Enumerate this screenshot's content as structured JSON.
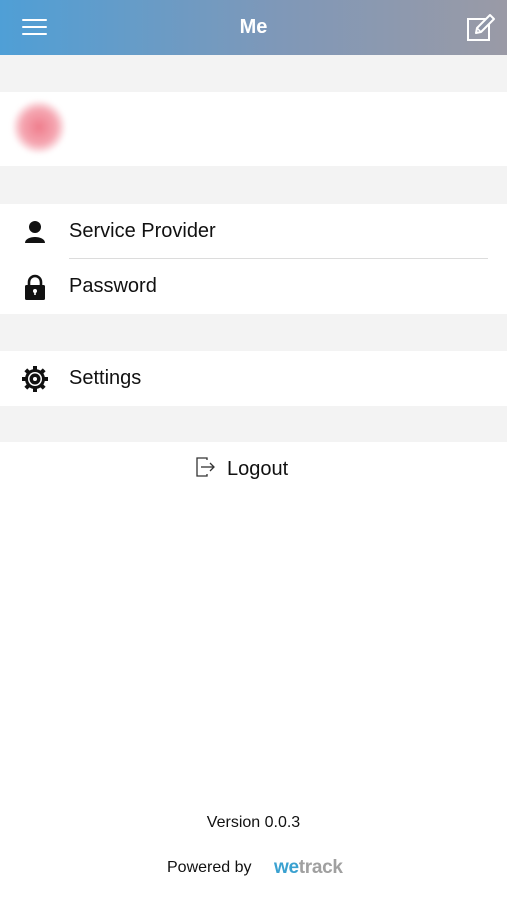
{
  "header": {
    "title": "Me",
    "menu_icon": "hamburger-menu-icon",
    "edit_icon": "edit-compose-icon",
    "gradient_start": "#4f9fd6",
    "gradient_end": "#9a9aa6"
  },
  "profile": {
    "avatar_color": "#ef7d8c",
    "name_redacted": true
  },
  "menu": {
    "group1": [
      {
        "label": "Service Provider",
        "icon": "person-icon"
      },
      {
        "label": "Password",
        "icon": "lock-icon"
      }
    ],
    "group2": [
      {
        "label": "Settings",
        "icon": "gear-icon"
      }
    ]
  },
  "logout": {
    "label": "Logout",
    "icon": "logout-icon"
  },
  "footer": {
    "version": "Version 0.0.3",
    "powered_by": "Powered by",
    "brand_we": "we",
    "brand_track": "track",
    "brand_colors": {
      "we": "#3aa1d0",
      "track": "#a0a0a0"
    }
  }
}
